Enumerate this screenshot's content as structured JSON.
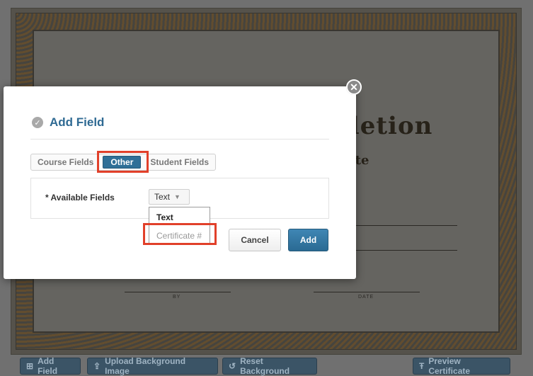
{
  "background": {
    "certificate": {
      "title_partial": "pletion",
      "subtitle_partial": "ate",
      "signature_labels": [
        "BY",
        "DATE"
      ]
    },
    "toolbar": {
      "add_field": "Add Field",
      "upload_background": "Upload Background Image",
      "reset_background": "Reset Background",
      "preview_certificate": "Preview Certificate"
    }
  },
  "modal": {
    "title": "Add Field",
    "close_icon": "close-icon",
    "tabs": [
      {
        "label": "Course Fields"
      },
      {
        "label": "Other",
        "active": true
      },
      {
        "label": "Student Fields"
      }
    ],
    "field_label": "* Available Fields",
    "select_value": "Text",
    "dropdown_options": [
      "Text",
      "Certificate #"
    ],
    "cancel_label": "Cancel",
    "add_label": "Add"
  },
  "colors": {
    "accent": "#2f6f97",
    "highlight": "#e1402a"
  }
}
